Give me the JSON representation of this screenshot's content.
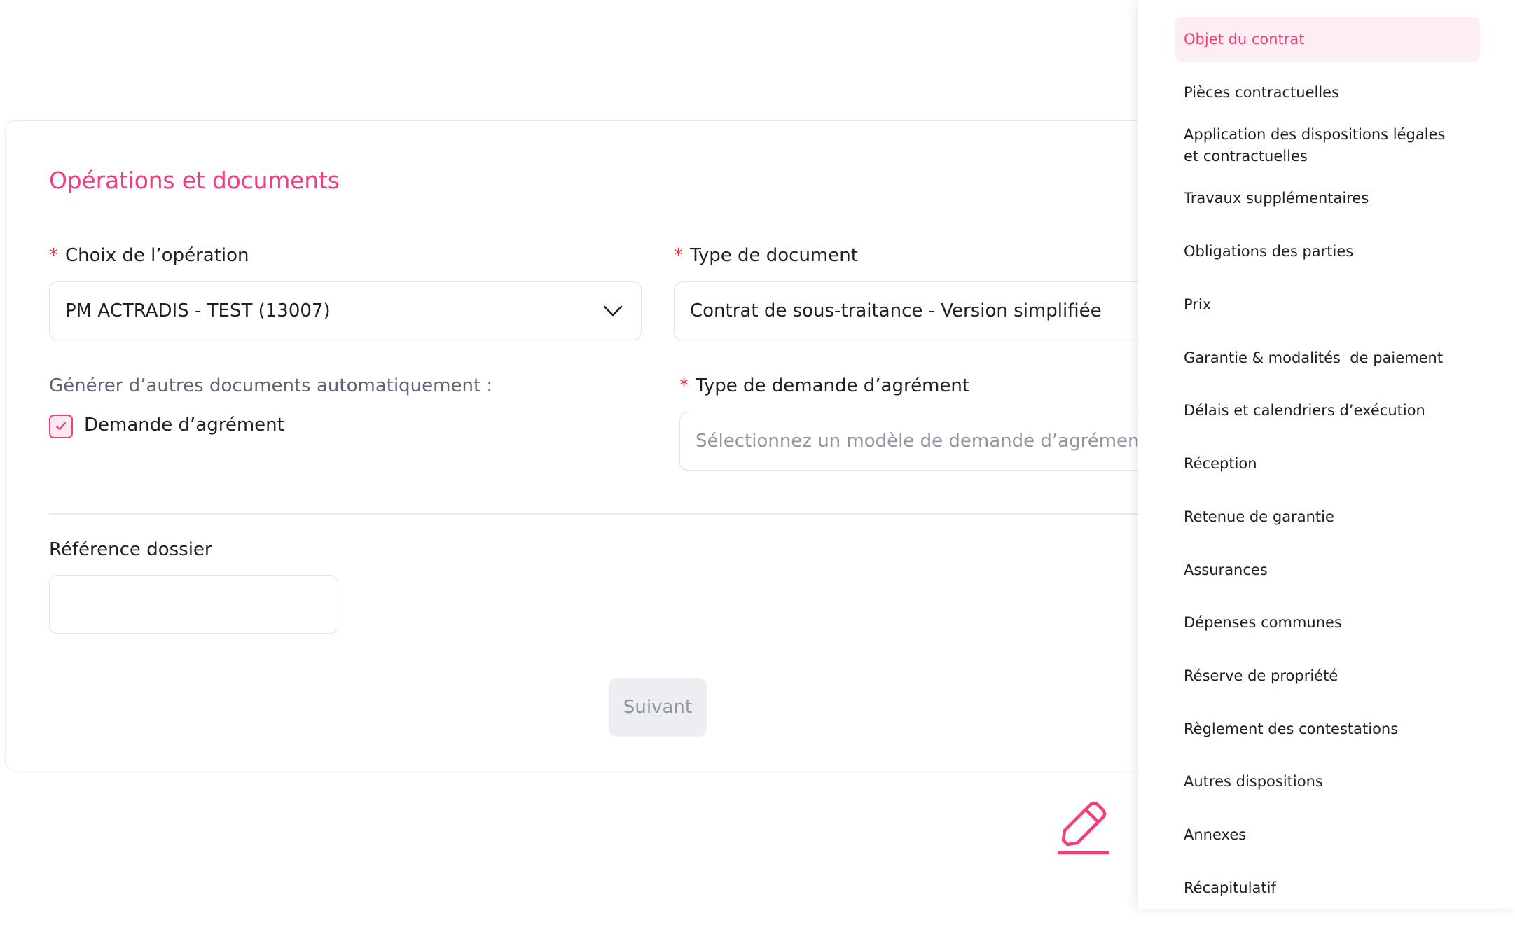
{
  "form": {
    "title": "Opérations et documents",
    "required_mark": "*",
    "operation": {
      "label": "Choix de l’opération",
      "value": "PM ACTRADIS - TEST (13007)"
    },
    "document_type": {
      "label": "Type de document",
      "value": "Contrat de sous-traitance - Version simplifiée"
    },
    "auto_generate": {
      "label": "Générer d’autres documents automatiquement :",
      "checkbox_label": "Demande d’agrément",
      "checked": true
    },
    "approval_type": {
      "label": "Type de demande d’agrément",
      "placeholder": "Sélectionnez un modèle de demande d’agrément"
    },
    "reference": {
      "label": "Référence dossier",
      "value": ""
    },
    "next_button": "Suivant"
  },
  "sidenav": {
    "items": [
      {
        "label": "Objet du contrat",
        "active": true
      },
      {
        "label": "Pièces contractuelles"
      },
      {
        "label": "Application des dispositions légales et contractuelles"
      },
      {
        "label": "Travaux supplémentaires"
      },
      {
        "label": "Obligations des parties"
      },
      {
        "label": "Prix"
      },
      {
        "label": "Garantie & modalités  de paiement"
      },
      {
        "label": "Délais et calendriers d’exécution"
      },
      {
        "label": "Réception"
      },
      {
        "label": "Retenue de garantie"
      },
      {
        "label": "Assurances"
      },
      {
        "label": "Dépenses communes"
      },
      {
        "label": "Réserve de propriété"
      },
      {
        "label": "Règlement des contestations"
      },
      {
        "label": "Autres dispositions"
      },
      {
        "label": "Annexes"
      },
      {
        "label": "Récapitulatif"
      }
    ]
  },
  "colors": {
    "accent": "#f13f7e",
    "required": "#e0363d",
    "active_bg": "#fdeef2"
  },
  "icons": {
    "select_chevron": "chevron-down-icon",
    "checkbox_mark": "check-icon",
    "edit": "pencil-icon"
  }
}
